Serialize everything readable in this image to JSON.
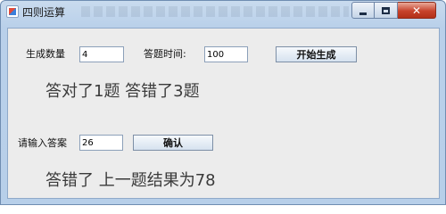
{
  "window": {
    "title": "四则运算",
    "controls": {
      "minimize": "minimize",
      "maximize": "maximize",
      "close": "✕"
    }
  },
  "form": {
    "count_label": "生成数量",
    "count_value": "4",
    "time_label": "答题时间:",
    "time_value": "100",
    "generate_button": "开始生成",
    "answer_label": "请输入答案",
    "answer_value": "26",
    "confirm_button": "确认"
  },
  "status": {
    "score_line": "答对了1题   答错了3题",
    "result_line": "答错了 上一题结果为78"
  },
  "icons": {
    "app": "app-icon",
    "minimize": "minimize-icon",
    "maximize": "maximize-icon",
    "close": "close-icon"
  },
  "colors": {
    "titlebar": "#b9d0ea",
    "close_button": "#c7432c",
    "client_background": "#ececec"
  }
}
